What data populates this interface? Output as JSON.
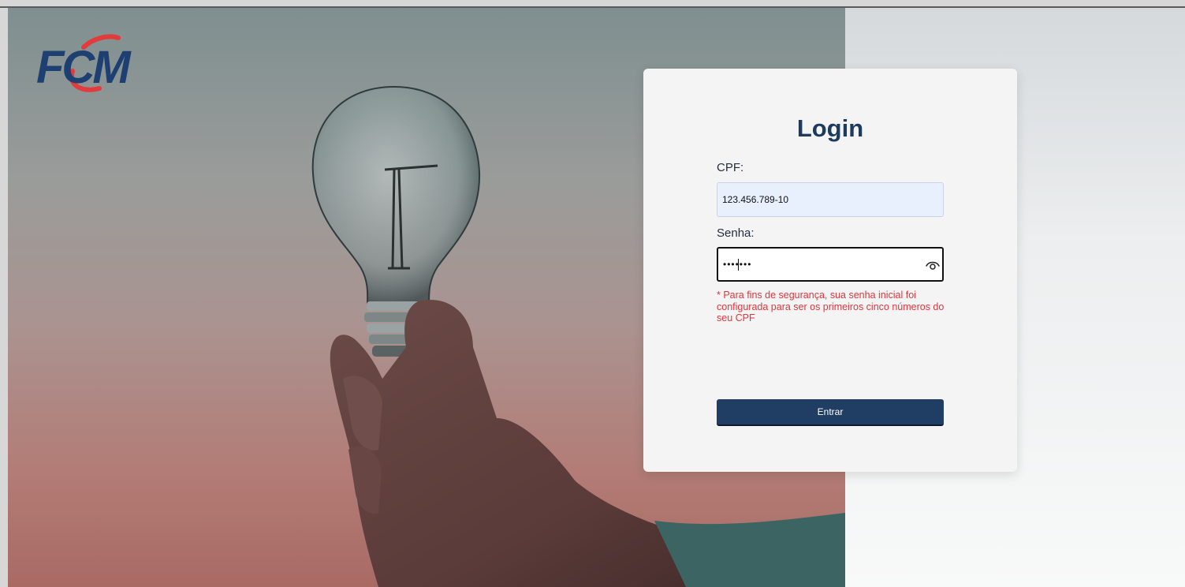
{
  "brand": {
    "logo_text": "FCM",
    "logo_color": "#1e3f72",
    "swoosh_color": "#e23b3b"
  },
  "login": {
    "title": "Login",
    "cpf_label": "CPF:",
    "cpf_value": "123.456.789-10",
    "senha_label": "Senha:",
    "senha_value": "•••••••",
    "show_password_icon": "eye-icon",
    "hint": "* Para fins de segurança, sua senha inicial foi configurada para ser os primeiros cinco números do seu CPF",
    "submit_label": "Entrar"
  },
  "colors": {
    "title": "#1d3a5f",
    "button": "#203d63",
    "hint": "#e1353d",
    "cpf_autofill_bg": "#e8f0fe"
  }
}
